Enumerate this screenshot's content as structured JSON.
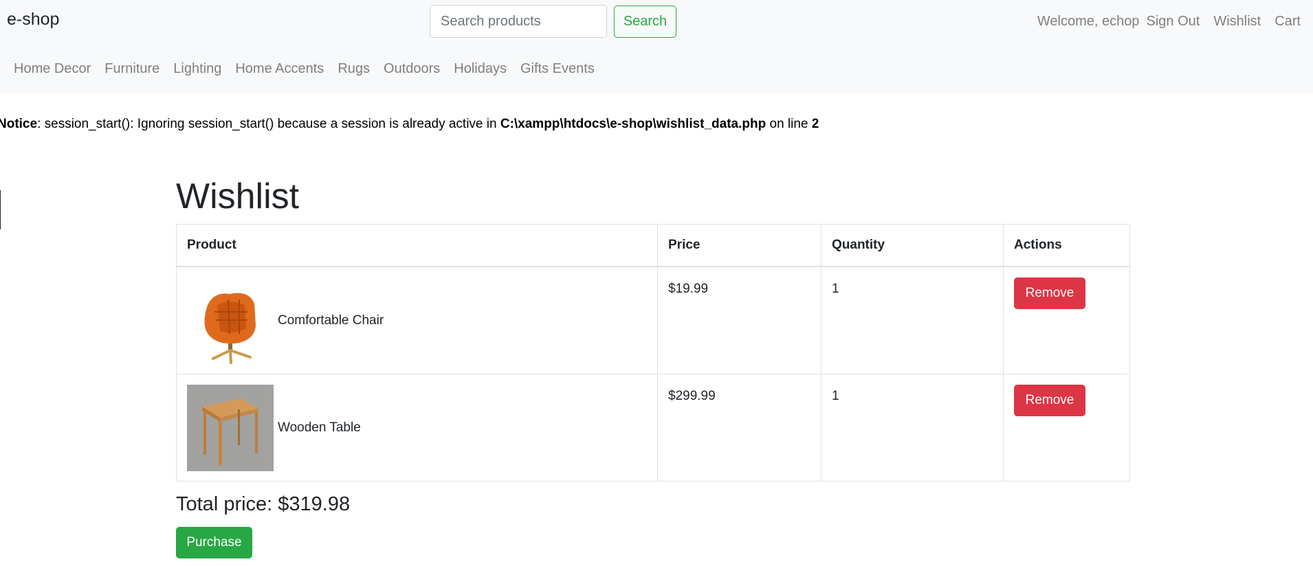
{
  "header": {
    "brand": "e-shop",
    "search_placeholder": "Search products",
    "search_button": "Search",
    "welcome": "Welcome, echop",
    "sign_out": "Sign Out",
    "wishlist": "Wishlist",
    "cart": "Cart"
  },
  "categories": [
    "Home Decor",
    "Furniture",
    "Lighting",
    "Home Accents",
    "Rugs",
    "Outdoors",
    "Holidays",
    "Gifts Events"
  ],
  "notice": {
    "label": "Notice",
    "message": ": session_start(): Ignoring session_start() because a session is already active in ",
    "path": "C:\\xampp\\htdocs\\e-shop\\wishlist_data.php",
    "on_line": " on line ",
    "line": "2"
  },
  "wishlist": {
    "title": "Wishlist",
    "columns": {
      "product": "Product",
      "price": "Price",
      "quantity": "Quantity",
      "actions": "Actions"
    },
    "rows": [
      {
        "product": "Comfortable Chair",
        "image_icon": "chair-image",
        "price": "$19.99",
        "quantity": "1",
        "action": "Remove"
      },
      {
        "product": "Wooden Table",
        "image_icon": "table-image",
        "price": "$299.99",
        "quantity": "1",
        "action": "Remove"
      }
    ],
    "total": "Total price: $319.98",
    "purchase": "Purchase"
  },
  "colors": {
    "navbar_bg": "#f8f9fa",
    "success": "#28a745",
    "danger": "#dc3545",
    "nav_link": "#7f7f7f"
  }
}
